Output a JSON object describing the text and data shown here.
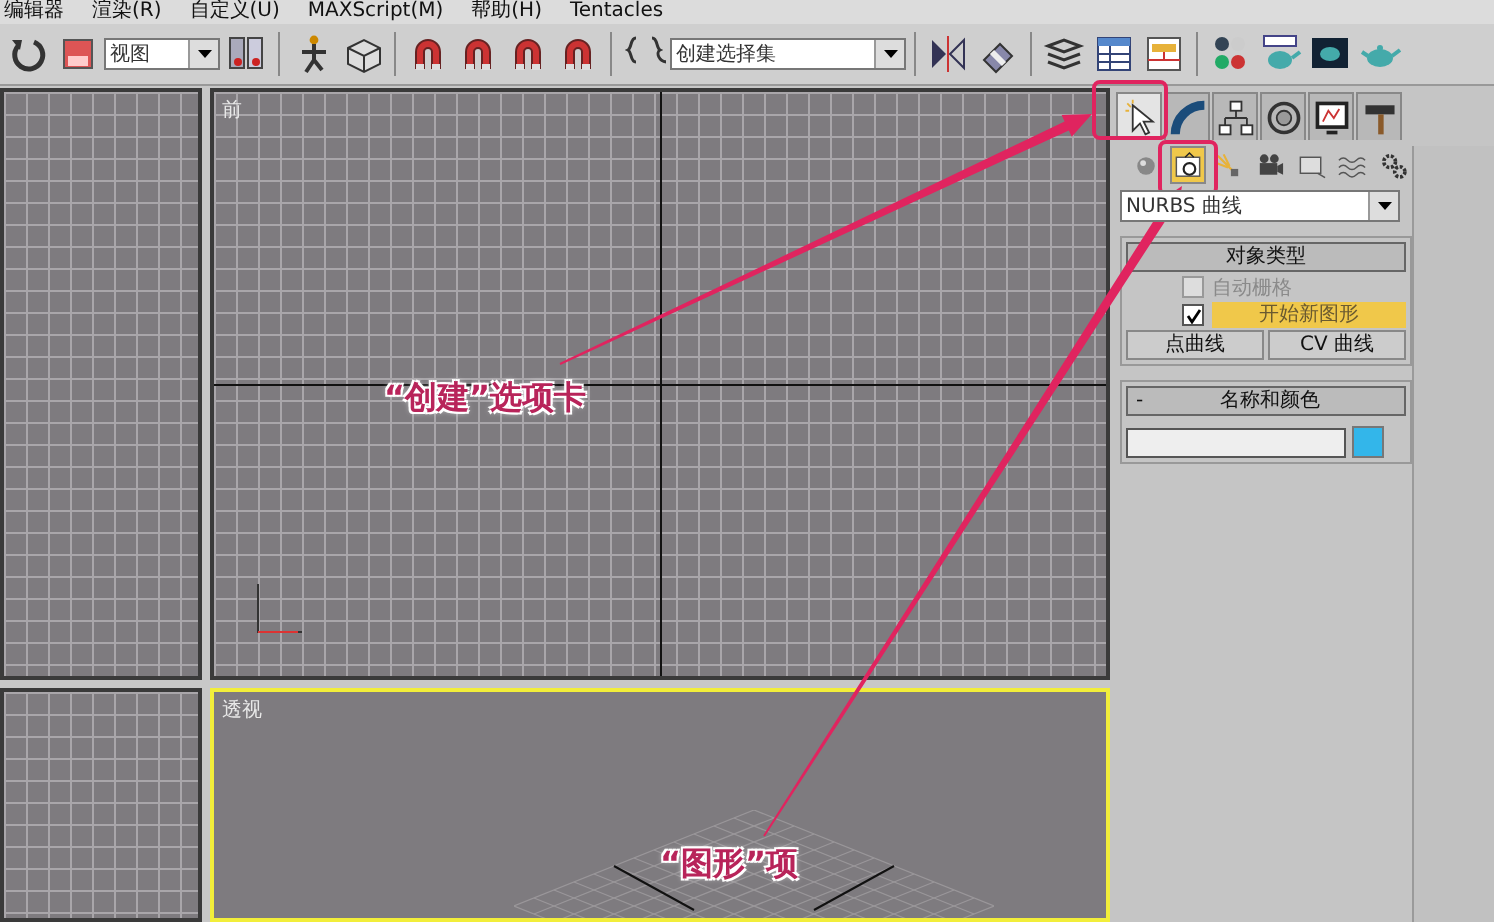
{
  "menu": [
    "编辑器",
    "渲染(R)",
    "自定义(U)",
    "MAXScript(M)",
    "帮助(H)",
    "Tentacles"
  ],
  "toolbar": {
    "view_dropdown": "视图",
    "selection_set_dropdown": "创建选择集"
  },
  "viewports": [
    {
      "label": "前",
      "active": false
    },
    {
      "label": "透视",
      "active": true
    }
  ],
  "command_panel": {
    "tabs": [
      {
        "selected": true
      },
      {
        "selected": false
      },
      {
        "selected": false
      },
      {
        "selected": false
      },
      {
        "selected": false
      },
      {
        "selected": false
      }
    ],
    "categories": [
      {
        "selected": false
      },
      {
        "selected": true
      },
      {
        "selected": false
      },
      {
        "selected": false
      },
      {
        "selected": false
      },
      {
        "selected": false
      },
      {
        "selected": false
      }
    ],
    "type_dropdown": "NURBS 曲线",
    "object_type": {
      "title": "对象类型",
      "auto_grid": {
        "label": "自动栅格",
        "checked": false,
        "disabled": true
      },
      "start_new_shape": {
        "label": "开始新图形",
        "checked": true
      },
      "buttons": [
        {
          "label": "点曲线",
          "selected": false
        },
        {
          "label": "CV 曲线",
          "selected": false
        }
      ]
    },
    "name_color": {
      "toggle": "-",
      "title": "名称和颜色"
    }
  },
  "annotations": [
    {
      "text": "“创建”选项卡"
    },
    {
      "text": "“图形”项"
    }
  ]
}
